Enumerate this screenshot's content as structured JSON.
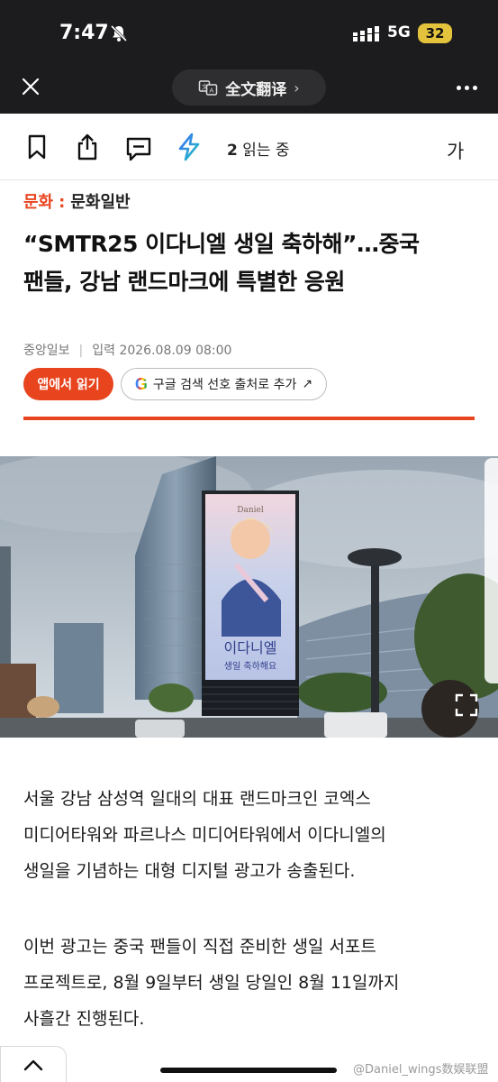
{
  "status_bar": {
    "time": "7:47",
    "network": "5G",
    "battery": "32"
  },
  "browser": {
    "translate_label": "全文翻译",
    "translate_chevron": "›"
  },
  "toolbar": {
    "readers_count": "2",
    "readers_suffix": " 읽는 중",
    "font_size_label": "가"
  },
  "article": {
    "section_main": "문화",
    "section_separator": ":",
    "section_sub": "문화일반",
    "headline_line1": "“SMTR25 이다니엘 생일 축하해”…중국",
    "headline_line2": "팬들, 강남 랜드마크에 특별한 응원",
    "source": "중앙일보",
    "byline_separator": "|",
    "published": "입력 2026.08.09 08:00",
    "app_button": "앱에서 읽기",
    "google_button": "구글 검색 선호 출처로 추가",
    "google_button_arrow": "↗",
    "photo": {
      "sign_brand": "Daniel",
      "sign_text_line1": "이다니엘",
      "sign_text_line2": "생일 축하해요"
    },
    "paragraph1": [
      "서울 강남 삼성역 일대의 대표 랜드마크인 코엑스",
      "미디어타워와 파르나스 미디어타워에서 이다니엘의",
      "생일을 기념하는 대형 디지털 광고가 송출된다."
    ],
    "paragraph2": [
      "이번 광고는 중국 팬들이 직접 준비한 생일 서포트",
      "프로젝트로, 8월 9일부터 생일 당일인 8월 11일까지",
      "사흘간 진행된다."
    ]
  },
  "watermark": "@Daniel_wings数娱联盟",
  "icons": {
    "close": "close-icon",
    "translate": "translate-icon",
    "more": "more-icon",
    "bookmark": "bookmark-icon",
    "share": "share-icon",
    "comment": "comment-icon",
    "ai": "ai-spark-icon",
    "google": "google-icon",
    "expand": "expand-icon",
    "up": "chevron-up-icon"
  },
  "colors": {
    "accent": "#e8441e",
    "chrome": "#1c1c1e",
    "battery": "#e3c23c"
  }
}
